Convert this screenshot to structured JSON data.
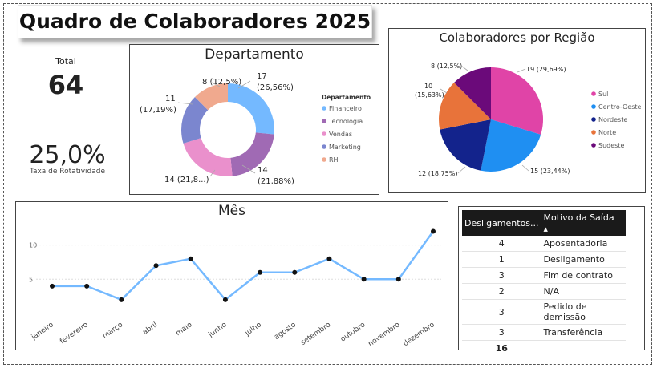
{
  "title": "Quadro de Colaboradores 2025",
  "kpis": {
    "total_label": "Total",
    "total_value": "64",
    "rate_value": "25,0%",
    "rate_label": "Taxa de Rotatividade"
  },
  "departamento": {
    "title": "Departamento",
    "legend_title": "Departamento",
    "labels": [
      "17",
      "(26,56%)",
      "14",
      "(21,88%)",
      "14 (21,8...)",
      "11",
      "(17,19%)",
      "8 (12,5%)"
    ]
  },
  "regiao": {
    "title": "Colaboradores por Região",
    "labels": [
      "19 (29,69%)",
      "15 (23,44%)",
      "12 (18,75%)",
      "10",
      "(15,63%)",
      "8 (12,5%)"
    ]
  },
  "mes": {
    "title": "Mês"
  },
  "motivos": {
    "header_count": "Desligamentos...",
    "header_reason": "Motivo da Saída",
    "rows": [
      {
        "count": "4",
        "reason": "Aposentadoria"
      },
      {
        "count": "1",
        "reason": "Desligamento"
      },
      {
        "count": "3",
        "reason": "Fim de contrato"
      },
      {
        "count": "2",
        "reason": "N/A"
      },
      {
        "count": "3",
        "reason": "Pedido de demissão"
      },
      {
        "count": "3",
        "reason": "Transferência"
      }
    ],
    "total": "16"
  },
  "chart_data": [
    {
      "type": "pie",
      "title": "Departamento",
      "legend_title": "Departamento",
      "donut": true,
      "categories": [
        "Financeiro",
        "Tecnologia",
        "Vendas",
        "Marketing",
        "RH"
      ],
      "values": [
        17,
        14,
        14,
        11,
        8
      ],
      "colors": [
        "#74b9ff",
        "#a06ab4",
        "#ea90cc",
        "#7b86cf",
        "#f0a98e"
      ],
      "legend": "right"
    },
    {
      "type": "pie",
      "title": "Colaboradores por Região",
      "categories": [
        "Sul",
        "Centro-Oeste",
        "Nordeste",
        "Norte",
        "Sudeste"
      ],
      "values": [
        19,
        15,
        12,
        10,
        8
      ],
      "colors": [
        "#e044a7",
        "#1f8ff2",
        "#13238c",
        "#e8733a",
        "#6b0a7a"
      ],
      "legend": "right"
    },
    {
      "type": "line",
      "title": "Mês",
      "categories": [
        "janeiro",
        "fevereiro",
        "março",
        "abril",
        "maio",
        "junho",
        "julho",
        "agosto",
        "setembro",
        "outubro",
        "novembro",
        "dezembro"
      ],
      "values": [
        4,
        4,
        2,
        7,
        8,
        2,
        6,
        6,
        8,
        5,
        5,
        12
      ],
      "yticks": [
        "5",
        "10"
      ],
      "ylim": [
        0,
        13
      ],
      "grid": true,
      "line_color": "#74b9ff"
    }
  ]
}
